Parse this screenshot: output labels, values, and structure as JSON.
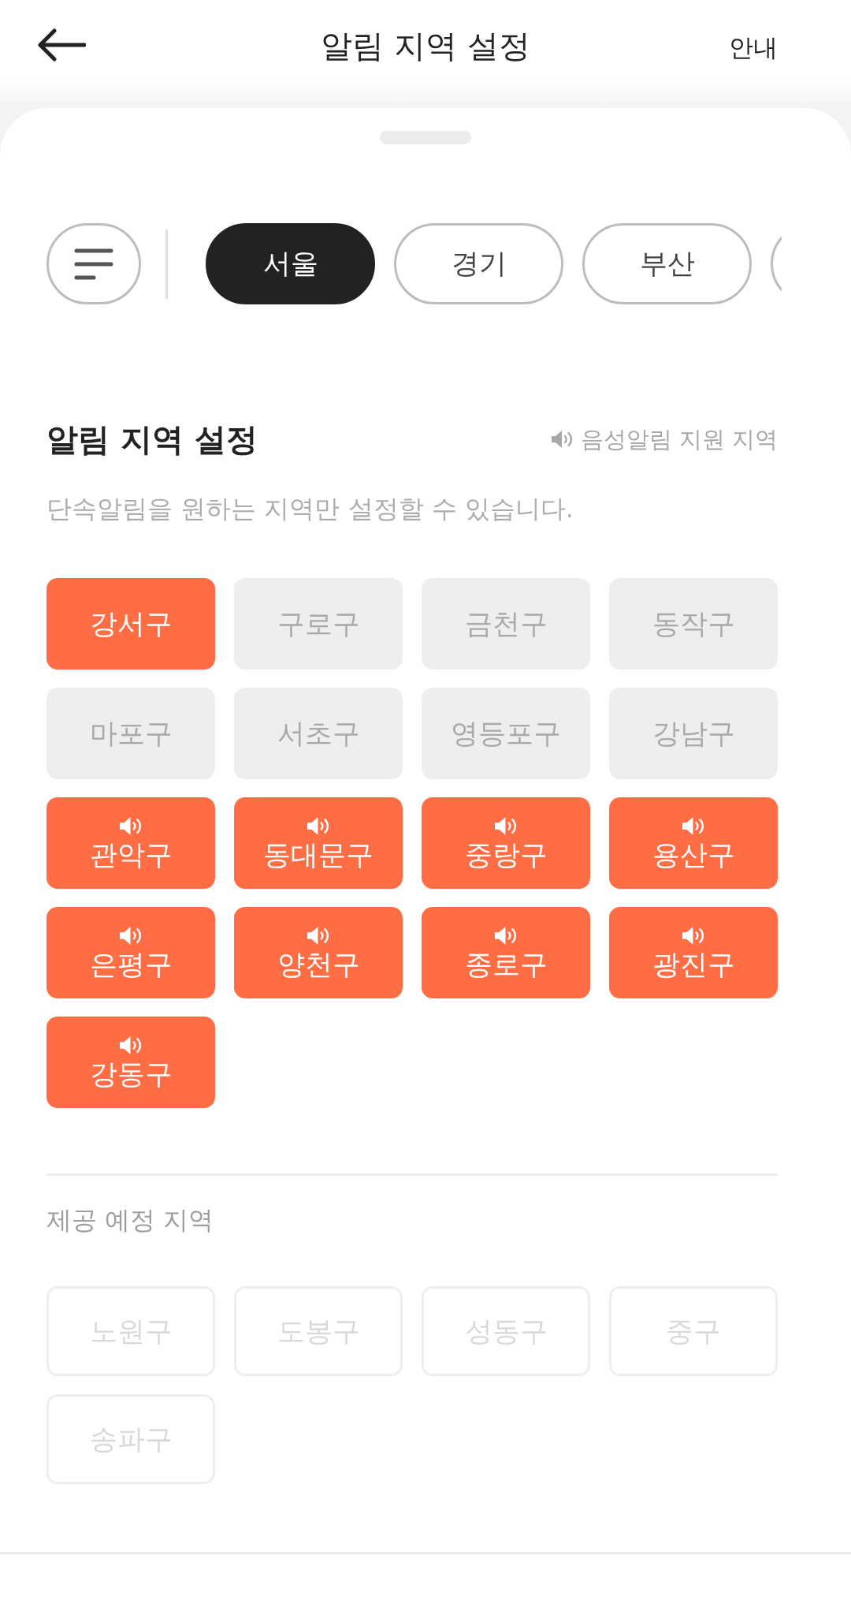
{
  "header": {
    "title": "알림 지역 설정",
    "action": "안내"
  },
  "region_tabs": [
    {
      "label": "서울",
      "selected": true
    },
    {
      "label": "경기",
      "selected": false
    },
    {
      "label": "부산",
      "selected": false
    },
    {
      "selected": false
    }
  ],
  "section": {
    "title": "알림 지역 설정",
    "voice_legend": "음성알림 지원 지역",
    "description": "단속알림을 원하는 지역만 설정할 수 있습니다.",
    "districts": [
      {
        "label": "강서구",
        "selected": true,
        "voice": false
      },
      {
        "label": "구로구",
        "selected": false,
        "voice": false
      },
      {
        "label": "금천구",
        "selected": false,
        "voice": false
      },
      {
        "label": "동작구",
        "selected": false,
        "voice": false
      },
      {
        "label": "마포구",
        "selected": false,
        "voice": false
      },
      {
        "label": "서초구",
        "selected": false,
        "voice": false
      },
      {
        "label": "영등포구",
        "selected": false,
        "voice": false
      },
      {
        "label": "강남구",
        "selected": false,
        "voice": false
      },
      {
        "label": "관악구",
        "selected": true,
        "voice": true
      },
      {
        "label": "동대문구",
        "selected": true,
        "voice": true
      },
      {
        "label": "중랑구",
        "selected": true,
        "voice": true
      },
      {
        "label": "용산구",
        "selected": true,
        "voice": true
      },
      {
        "label": "은평구",
        "selected": true,
        "voice": true
      },
      {
        "label": "양천구",
        "selected": true,
        "voice": true
      },
      {
        "label": "종로구",
        "selected": true,
        "voice": true
      },
      {
        "label": "광진구",
        "selected": true,
        "voice": true
      },
      {
        "label": "강동구",
        "selected": true,
        "voice": true
      }
    ]
  },
  "upcoming": {
    "title": "제공 예정 지역",
    "districts": [
      {
        "label": "노원구",
        "disabled": true
      },
      {
        "label": "도봉구",
        "disabled": true
      },
      {
        "label": "성동구",
        "disabled": true
      },
      {
        "label": "중구",
        "disabled": true
      },
      {
        "label": "송파구",
        "disabled": true
      }
    ]
  }
}
